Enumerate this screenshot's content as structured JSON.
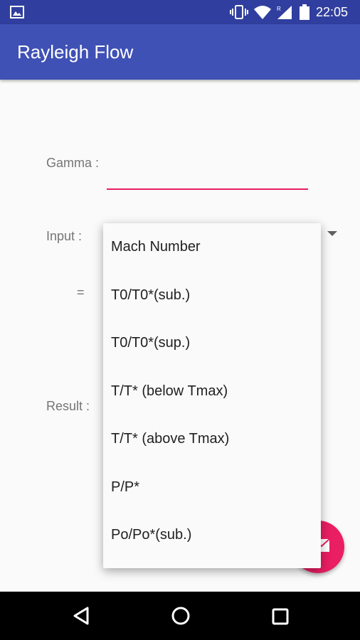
{
  "status_bar": {
    "time": "22:05",
    "icons": [
      "image-icon",
      "vibrate-icon",
      "wifi-icon",
      "signal-icon",
      "battery-icon"
    ]
  },
  "app_bar": {
    "title": "Rayleigh Flow"
  },
  "form": {
    "gamma_label": "Gamma :",
    "input_label": "Input :",
    "equals_label": "=",
    "result_label": "Result :"
  },
  "dropdown": {
    "options": [
      "Mach Number",
      "T0/T0*(sub.)",
      "T0/T0*(sup.)",
      "T/T* (below Tmax)",
      "T/T* (above Tmax)",
      "P/P*",
      "Po/Po*(sub.)"
    ]
  },
  "fab": {
    "icon": "envelope-icon"
  },
  "colors": {
    "primary": "#3f51b5",
    "primary_dark": "#303f9f",
    "accent": "#e91e63"
  },
  "nav_bar": {
    "icons": [
      "back-icon",
      "home-icon",
      "recents-icon"
    ]
  }
}
